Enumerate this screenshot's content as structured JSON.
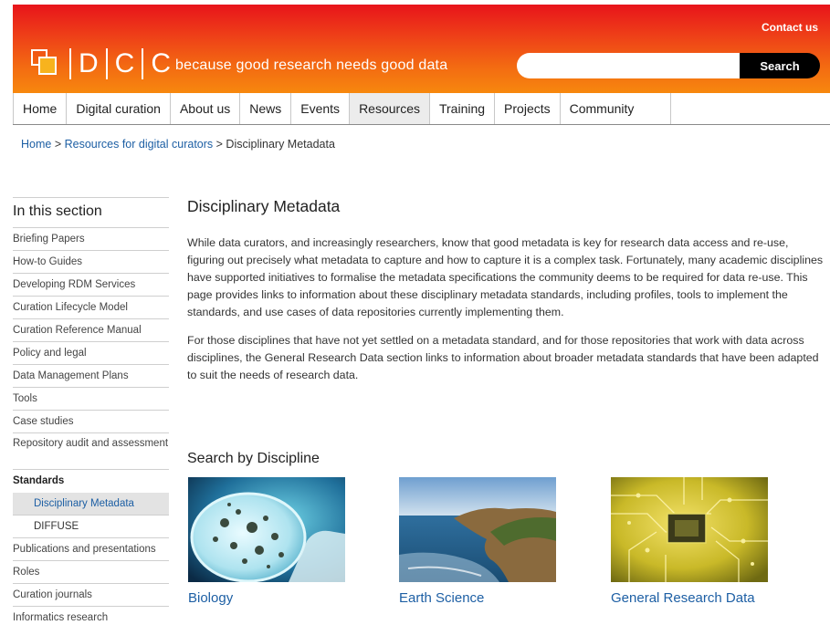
{
  "header": {
    "contact": "Contact us",
    "logo_letters": [
      "D",
      "C",
      "C"
    ],
    "tagline": "because good research needs good data",
    "search_placeholder": "",
    "search_button": "Search"
  },
  "nav": {
    "items": [
      "Home",
      "Digital curation",
      "About us",
      "News",
      "Events",
      "Resources",
      "Training",
      "Projects",
      "Community"
    ],
    "active": "Resources"
  },
  "breadcrumb": {
    "home": "Home",
    "sep1": " > ",
    "resources": "Resources for digital curators",
    "sep2": " > ",
    "current": "Disciplinary Metadata"
  },
  "sidebar": {
    "heading": "In this section",
    "items": [
      "Briefing Papers",
      "How-to Guides",
      "Developing RDM Services",
      "Curation Lifecycle Model",
      "Curation Reference Manual",
      "Policy and legal",
      "Data Management Plans",
      "Tools",
      "Case studies",
      "Repository audit and assessment",
      "Standards",
      "Disciplinary Metadata",
      "DIFFUSE",
      "Publications and presentations",
      "Roles",
      "Curation journals",
      "Informatics research"
    ]
  },
  "content": {
    "title": "Disciplinary Metadata",
    "para1": "While data curators, and increasingly researchers, know that good metadata is key for research data access and re-use, figuring out precisely what metadata to capture and how to capture it is a complex task. Fortunately, many academic disciplines have supported initiatives to formalise the metadata specifications the community deems to be required for data re-use. This page provides links to information about these disciplinary metadata standards, including profiles, tools to implement the standards, and use cases of data repositories currently implementing them.",
    "para2": "For those disciplines that have not yet settled on a metadata standard, and for those repositories that work with data across disciplines, the General Research Data section links to information about broader metadata standards that have been adapted to suit the needs of research data.",
    "search_heading": "Search by Discipline",
    "disciplines": [
      "Biology",
      "Earth Science",
      "General Research Data"
    ]
  },
  "colors": {
    "header_top": "#e8141b",
    "header_bottom": "#f7880e",
    "link": "#1d5fa4"
  }
}
